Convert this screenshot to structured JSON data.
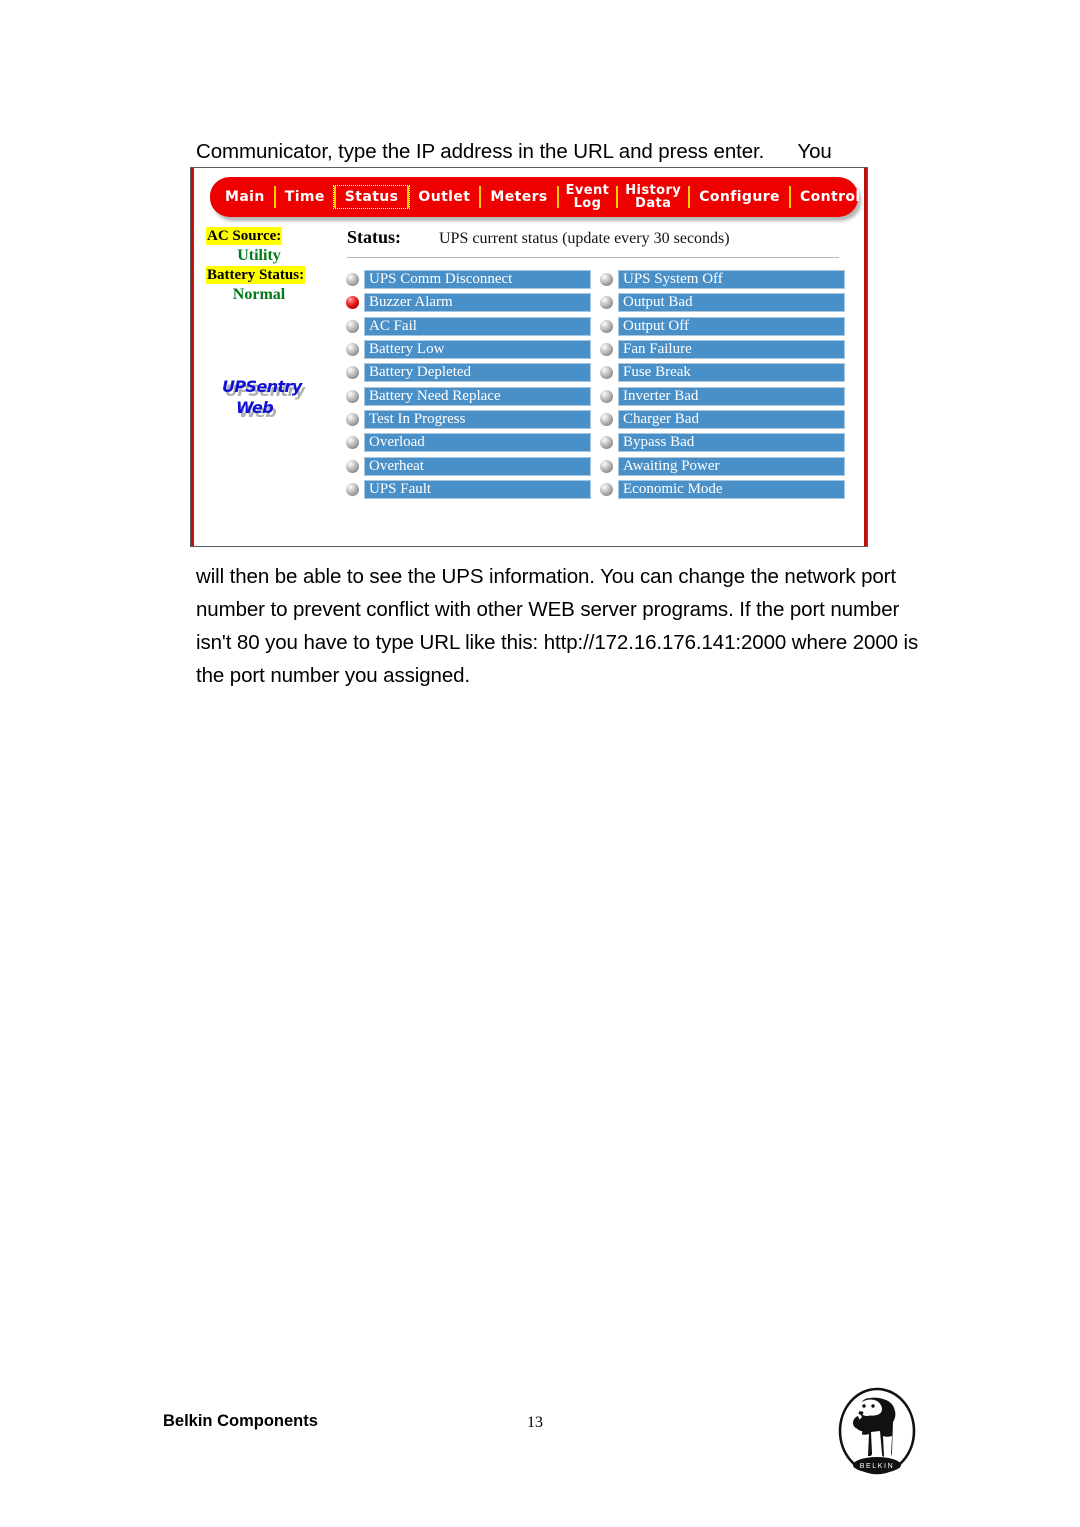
{
  "document": {
    "intro_line": "Communicator, type the IP address in the URL and press enter.      You",
    "body_paragraph": "will then be able to see the UPS information. You can change the network port number to prevent conflict with other WEB server programs. If the port number isn't 80 you have to type URL like this: http://172.16.176.141:2000 where 2000 is the port number you assigned.",
    "footer": {
      "brand": "Belkin Components",
      "page_number": "13",
      "logo_text": "BELKIN"
    }
  },
  "screenshot": {
    "nav": {
      "items": [
        {
          "label": "Main",
          "selected": false,
          "two_line": false
        },
        {
          "label": "Time",
          "selected": false,
          "two_line": false
        },
        {
          "label": "Status",
          "selected": true,
          "two_line": false
        },
        {
          "label": "Outlet",
          "selected": false,
          "two_line": false
        },
        {
          "label": "Meters",
          "selected": false,
          "two_line": false
        },
        {
          "label": "Event\nLog",
          "selected": false,
          "two_line": true
        },
        {
          "label": "History\nData",
          "selected": false,
          "two_line": true
        },
        {
          "label": "Configure",
          "selected": false,
          "two_line": false
        },
        {
          "label": "Control",
          "selected": false,
          "two_line": false
        }
      ]
    },
    "sidebar": {
      "ac_source_label": "AC Source:",
      "ac_source_value": "Utility",
      "battery_status_label": "Battery Status:",
      "battery_status_value": "Normal",
      "logo_line1": "UPSentry",
      "logo_line2": "Web"
    },
    "status_panel": {
      "title": "Status:",
      "subtitle": "UPS current status (update every 30 seconds)",
      "left_column": [
        {
          "label": "UPS Comm Disconnect",
          "active": false
        },
        {
          "label": "Buzzer Alarm",
          "active": true
        },
        {
          "label": "AC Fail",
          "active": false
        },
        {
          "label": "Battery Low",
          "active": false
        },
        {
          "label": "Battery Depleted",
          "active": false
        },
        {
          "label": "Battery Need Replace",
          "active": false
        },
        {
          "label": "Test In Progress",
          "active": false
        },
        {
          "label": "Overload",
          "active": false
        },
        {
          "label": "Overheat",
          "active": false
        },
        {
          "label": "UPS Fault",
          "active": false
        }
      ],
      "right_column": [
        {
          "label": "UPS System Off",
          "active": false
        },
        {
          "label": "Output Bad",
          "active": false
        },
        {
          "label": "Output Off",
          "active": false
        },
        {
          "label": "Fan Failure",
          "active": false
        },
        {
          "label": "Fuse Break",
          "active": false
        },
        {
          "label": "Inverter Bad",
          "active": false
        },
        {
          "label": "Charger Bad",
          "active": false
        },
        {
          "label": "Bypass Bad",
          "active": false
        },
        {
          "label": "Awaiting Power",
          "active": false
        },
        {
          "label": "Economic Mode",
          "active": false
        }
      ]
    },
    "colors": {
      "nav_red": "#ee0000",
      "nav_separator": "#ffcc00",
      "status_bar_blue": "#4a90c8",
      "highlight_yellow": "#ffff00",
      "value_green": "#007a18",
      "led_on_red": "#e01414",
      "logo_blue": "#1010d8"
    }
  }
}
